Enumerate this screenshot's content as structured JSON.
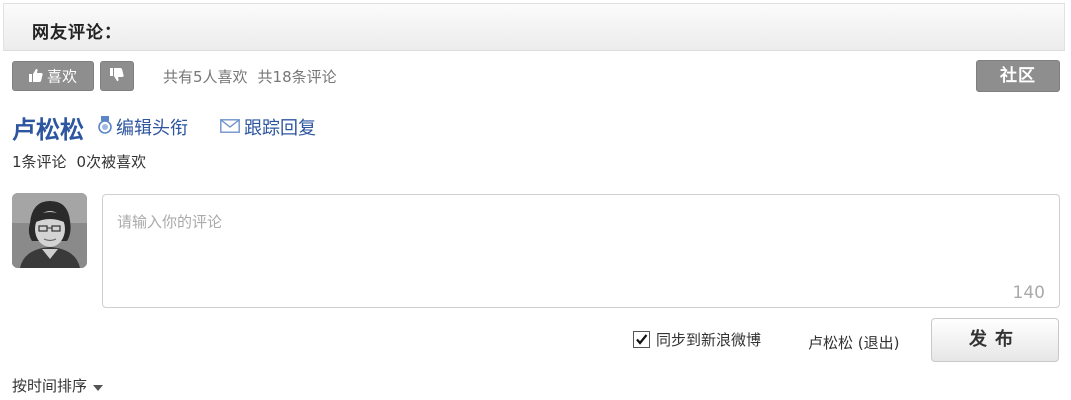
{
  "header": {
    "title": "网友评论："
  },
  "toolbar": {
    "like_label": "喜欢",
    "stats": {
      "likes_text": "共有5人喜欢",
      "comments_text": "共18条评论"
    },
    "community_label": "社区"
  },
  "user": {
    "name": "卢松松",
    "edit_title_label": "编辑头衔",
    "follow_reply_label": "跟踪回复",
    "comments_count_text": "1条评论",
    "liked_count_text": "0次被喜欢"
  },
  "comment": {
    "placeholder": "请输入你的评论",
    "char_count": "140"
  },
  "footer": {
    "sync_label": "同步到新浪微博",
    "sync_checked": true,
    "login_name": "卢松松",
    "logout_label": "(退出)",
    "publish_label": "发布"
  },
  "sort": {
    "label": "按时间排序"
  },
  "colors": {
    "accent_blue": "#2d55a0",
    "button_gray": "#8e8e8e"
  }
}
